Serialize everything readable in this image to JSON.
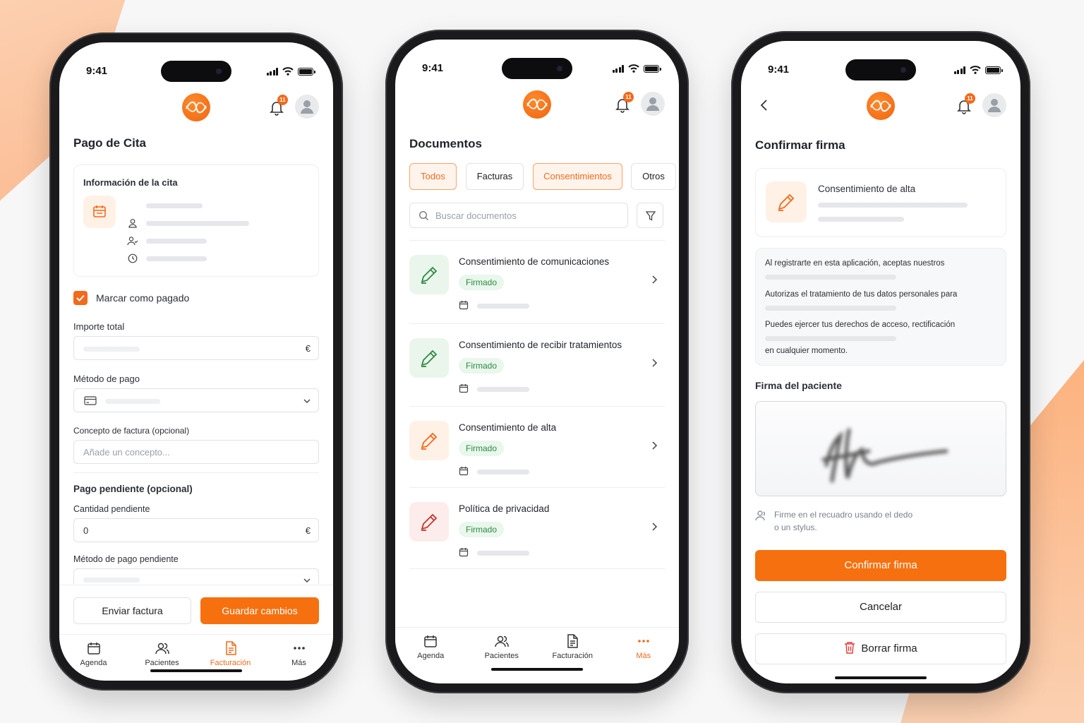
{
  "status": {
    "time": "9:41"
  },
  "notifications_count": "11",
  "colors": {
    "accent": "#f26a1b",
    "success": "#2f8a43",
    "danger": "#e23b3b"
  },
  "phone1": {
    "title": "Pago de Cita",
    "info_card_title": "Información de la cita",
    "mark_paid_label": "Marcar como pagado",
    "total_label": "Importe total",
    "currency": "€",
    "payment_method_label": "Método de pago",
    "concept_label": "Concepto de factura (opcional)",
    "concept_placeholder": "Añade un concepto...",
    "pending_section": "Pago pendiente (opcional)",
    "pending_amount_label": "Cantidad pendiente",
    "pending_amount_value": "0",
    "pending_method_label": "Método de pago pendiente",
    "send_invoice": "Enviar factura",
    "save_changes": "Guardar cambios"
  },
  "phone2": {
    "title": "Documentos",
    "filters": [
      "Todos",
      "Facturas",
      "Consentimientos",
      "Otros"
    ],
    "search_placeholder": "Buscar documentos",
    "documents": [
      {
        "title": "Consentimiento de comunicaciones",
        "status": "Firmado",
        "icon": "pencil-icon",
        "icon_color": "#2f8a43"
      },
      {
        "title": "Consentimiento de recibir tratamientos",
        "status": "Firmado",
        "icon": "pencil-icon",
        "icon_color": "#2f8a43"
      },
      {
        "title": "Consentimiento de alta",
        "status": "Firmado",
        "icon": "pencil-icon",
        "icon_color": "#f26a1b"
      },
      {
        "title": "Política de privacidad",
        "status": "Firmado",
        "icon": "pencil-icon",
        "icon_color": "#c0392b"
      }
    ]
  },
  "phone3": {
    "title": "Confirmar firma",
    "doc_title": "Consentimiento de alta",
    "consent_lines": [
      "Al registrarte en esta aplicación, aceptas nuestros",
      "Autorizas el tratamiento de tus datos personales para",
      "Puedes ejercer tus derechos de acceso, rectificación",
      "en cualquier momento."
    ],
    "signature_label": "Firma del paciente",
    "hint_line1": "Firme en el recuadro usando el dedo",
    "hint_line2": "o un stylus.",
    "confirm": "Confirmar firma",
    "cancel": "Cancelar",
    "clear": "Borrar firma"
  },
  "tabbar": {
    "items": [
      "Agenda",
      "Pacientes",
      "Facturación",
      "Más"
    ],
    "phone1_active": "Facturación",
    "phone2_active": "Más"
  }
}
